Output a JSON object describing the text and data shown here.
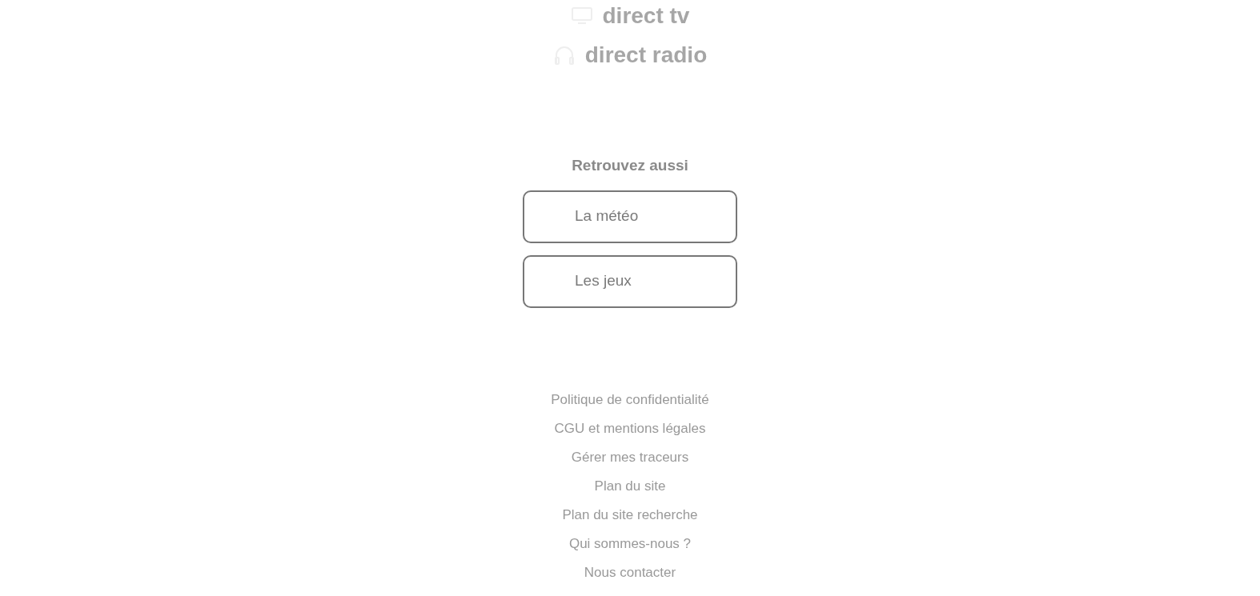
{
  "live_links": [
    {
      "kind": "tv",
      "label": "direct tv"
    },
    {
      "kind": "radio",
      "label": "direct radio"
    }
  ],
  "see_also": {
    "title": "Retrouvez aussi",
    "items": [
      "La météo",
      "Les jeux"
    ]
  },
  "footer_links": [
    "Politique de confidentialité",
    "CGU et mentions légales",
    "Gérer mes traceurs",
    "Plan du site",
    "Plan du site recherche",
    "Qui sommes-nous ?",
    "Nous contacter"
  ]
}
